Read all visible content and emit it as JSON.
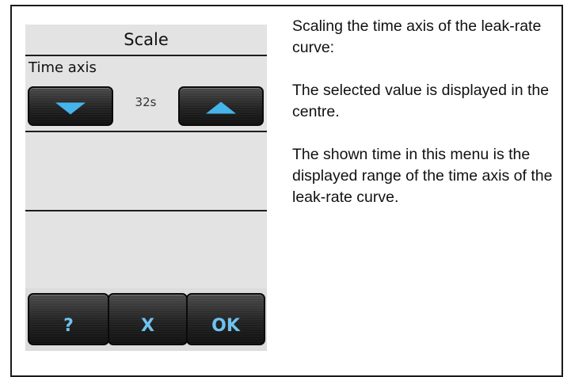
{
  "screen": {
    "title": "Scale",
    "section_label": "Time axis",
    "selected_value": "32s",
    "buttons": {
      "help": "?",
      "cancel": "X",
      "ok": "OK"
    },
    "icons": {
      "decrease": "triangle-down",
      "increase": "triangle-up"
    },
    "accent_color": "#46b4ea"
  },
  "description": {
    "p1": "Scaling the time axis of the leak-rate curve:",
    "p2": "The selected value is displayed in the centre.",
    "p3": "The shown time in this menu is the displayed range of the time axis of the leak-rate curve."
  }
}
